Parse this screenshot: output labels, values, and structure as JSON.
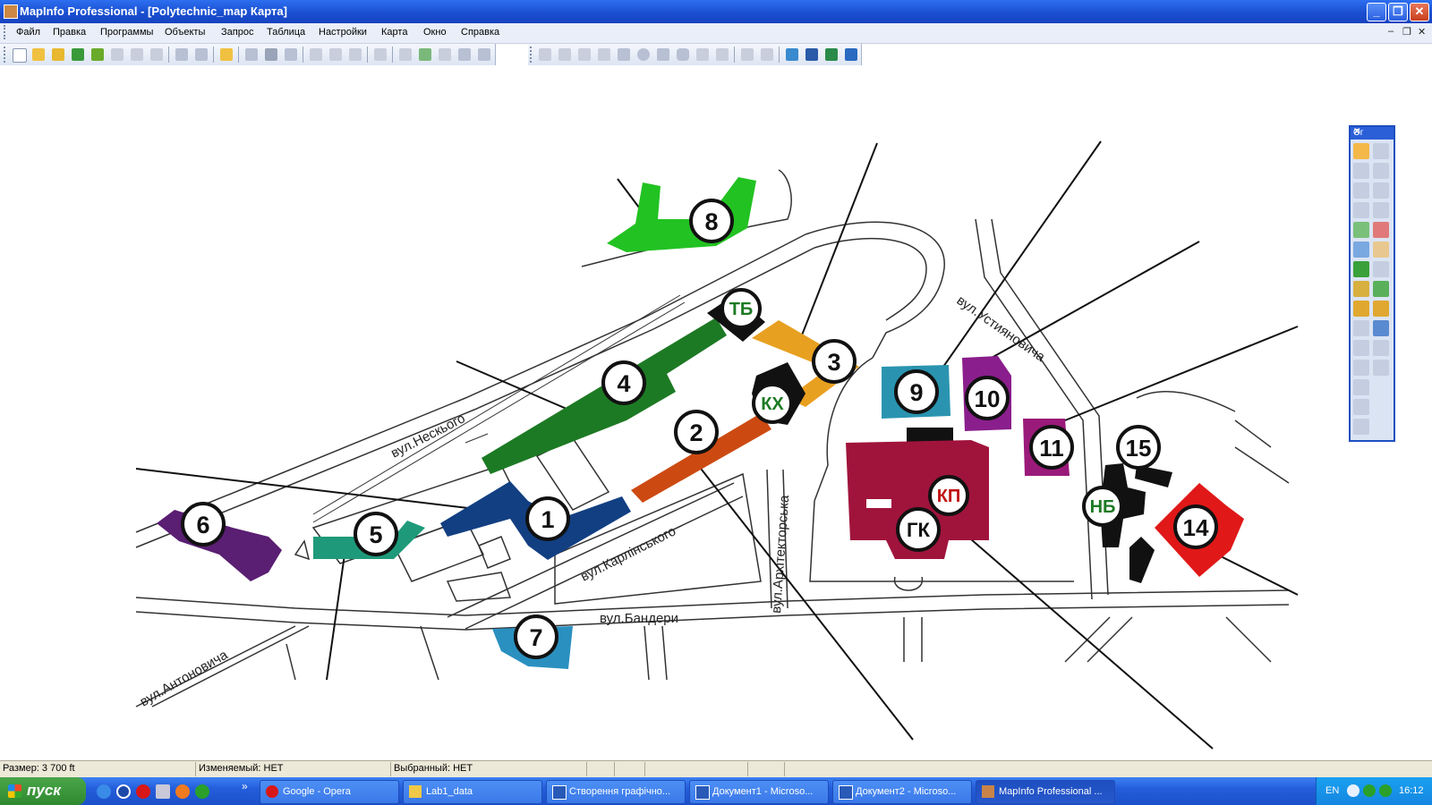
{
  "window": {
    "title": "MapInfo Professional - [Polytechnic_map Карта]"
  },
  "menu": {
    "items": [
      "Файл",
      "Правка",
      "Программы",
      "Объекты",
      "Запрос",
      "Таблица",
      "Настройки",
      "Карта",
      "Окно",
      "Справка"
    ]
  },
  "map": {
    "street_labels": {
      "neskoho": "вул.Нескього",
      "karlinskoho": "вул.Карлінського",
      "arkhitektorska": "вул.Архітекторська",
      "bandery": "вул.Бандери",
      "antonovycha": "вул.Антоновича",
      "ustyianovycha": "вул.Устияновича"
    },
    "markers": {
      "b1": "1",
      "b2": "2",
      "b3": "3",
      "b4": "4",
      "b5": "5",
      "b6": "6",
      "b7": "7",
      "b8": "8",
      "b9": "9",
      "b10": "10",
      "b11": "11",
      "b14": "14",
      "b15": "15",
      "tb": "ТБ",
      "kh": "КХ",
      "kp": "КП",
      "gk": "ГК",
      "nb": "НБ"
    },
    "colors": {
      "b1": "#123f82",
      "b2": "#cc4a12",
      "b3": "#e8a020",
      "b4": "#1d7a24",
      "b5": "#1e9a7a",
      "b6": "#5a1e72",
      "b7": "#2a90c0",
      "b8": "#22c222",
      "b9": "#2a94b0",
      "b10": "#8a1e8c",
      "b11": "#9a1a7a",
      "b14": "#e01818",
      "gk": "#a0143c",
      "black": "#111111"
    }
  },
  "palette": {
    "title": "Ог"
  },
  "status": {
    "size": "Размер: 3 700 ft",
    "editable": "Изменяемый: НЕТ",
    "selected": "Выбранный: НЕТ"
  },
  "taskbar": {
    "start_label": "пуск",
    "chevron": "»",
    "buttons": [
      "Google - Opera",
      "Lab1_data",
      "Створення графічно...",
      "Документ1 - Microso...",
      "Документ2 - Microso...",
      "MapInfo Professional ..."
    ],
    "lang": "EN",
    "clock": "16:12"
  }
}
